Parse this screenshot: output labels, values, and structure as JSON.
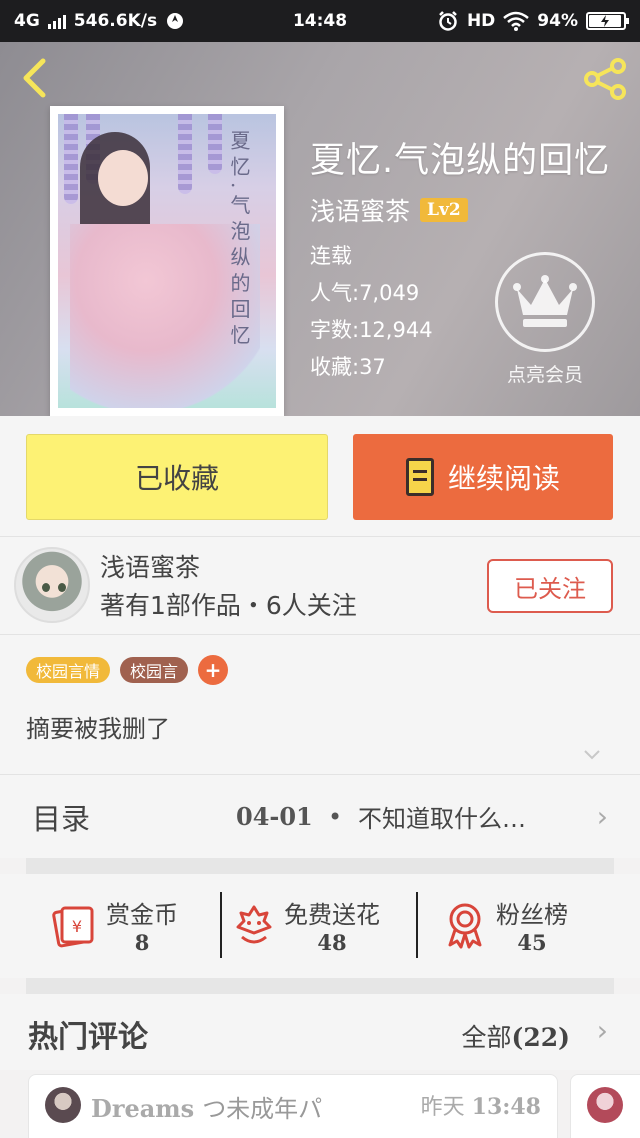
{
  "status_bar": {
    "network": "4G",
    "speed": "546.6K/s",
    "time": "14:48",
    "hd": "HD",
    "battery": "94%"
  },
  "header": {
    "back_icon": "chevron-left-icon",
    "share_icon": "share-icon"
  },
  "book": {
    "title": "夏忆.气泡纵的回忆",
    "cover_text": "夏忆.气泡纵的回忆",
    "author": "浅语蜜茶",
    "level": "Lv2",
    "status": "连载",
    "popularity": "人气:7,049",
    "word_count": "字数:12,944",
    "favorites": "收藏:37",
    "vip_label": "点亮会员"
  },
  "actions": {
    "collected_label": "已收藏",
    "continue_label": "继续阅读"
  },
  "author_card": {
    "name": "浅语蜜茶",
    "works": "著有1部作品・6人关注",
    "follow_label": "已关注"
  },
  "tags": [
    {
      "label": "校园言情",
      "color": "#f1b93a"
    },
    {
      "label": "校园言",
      "color": "#a0614f"
    }
  ],
  "tag_add": "+",
  "summary": "摘要被我删了",
  "toc": {
    "label": "目录",
    "date": "04-01",
    "dot": "•",
    "latest": "不知道取什么…"
  },
  "rewards": [
    {
      "label": "赏金币",
      "value": "8",
      "icon": "red-envelope-icon"
    },
    {
      "label": "免费送花",
      "value": "48",
      "icon": "flower-icon"
    },
    {
      "label": "粉丝榜",
      "value": "45",
      "icon": "award-ribbon-icon"
    }
  ],
  "comments": {
    "title": "热门评论",
    "all_label": "全部",
    "count": "(22)",
    "first": {
      "user": "Dreams",
      "nickname": "つ未成年パ",
      "day": "昨天",
      "time": "13:48"
    }
  },
  "colors": {
    "accent_orange": "#ec6b3f",
    "collected_yellow": "#fdf274",
    "follow_red": "#dd5b4e",
    "level_gold": "#f1b93a"
  }
}
